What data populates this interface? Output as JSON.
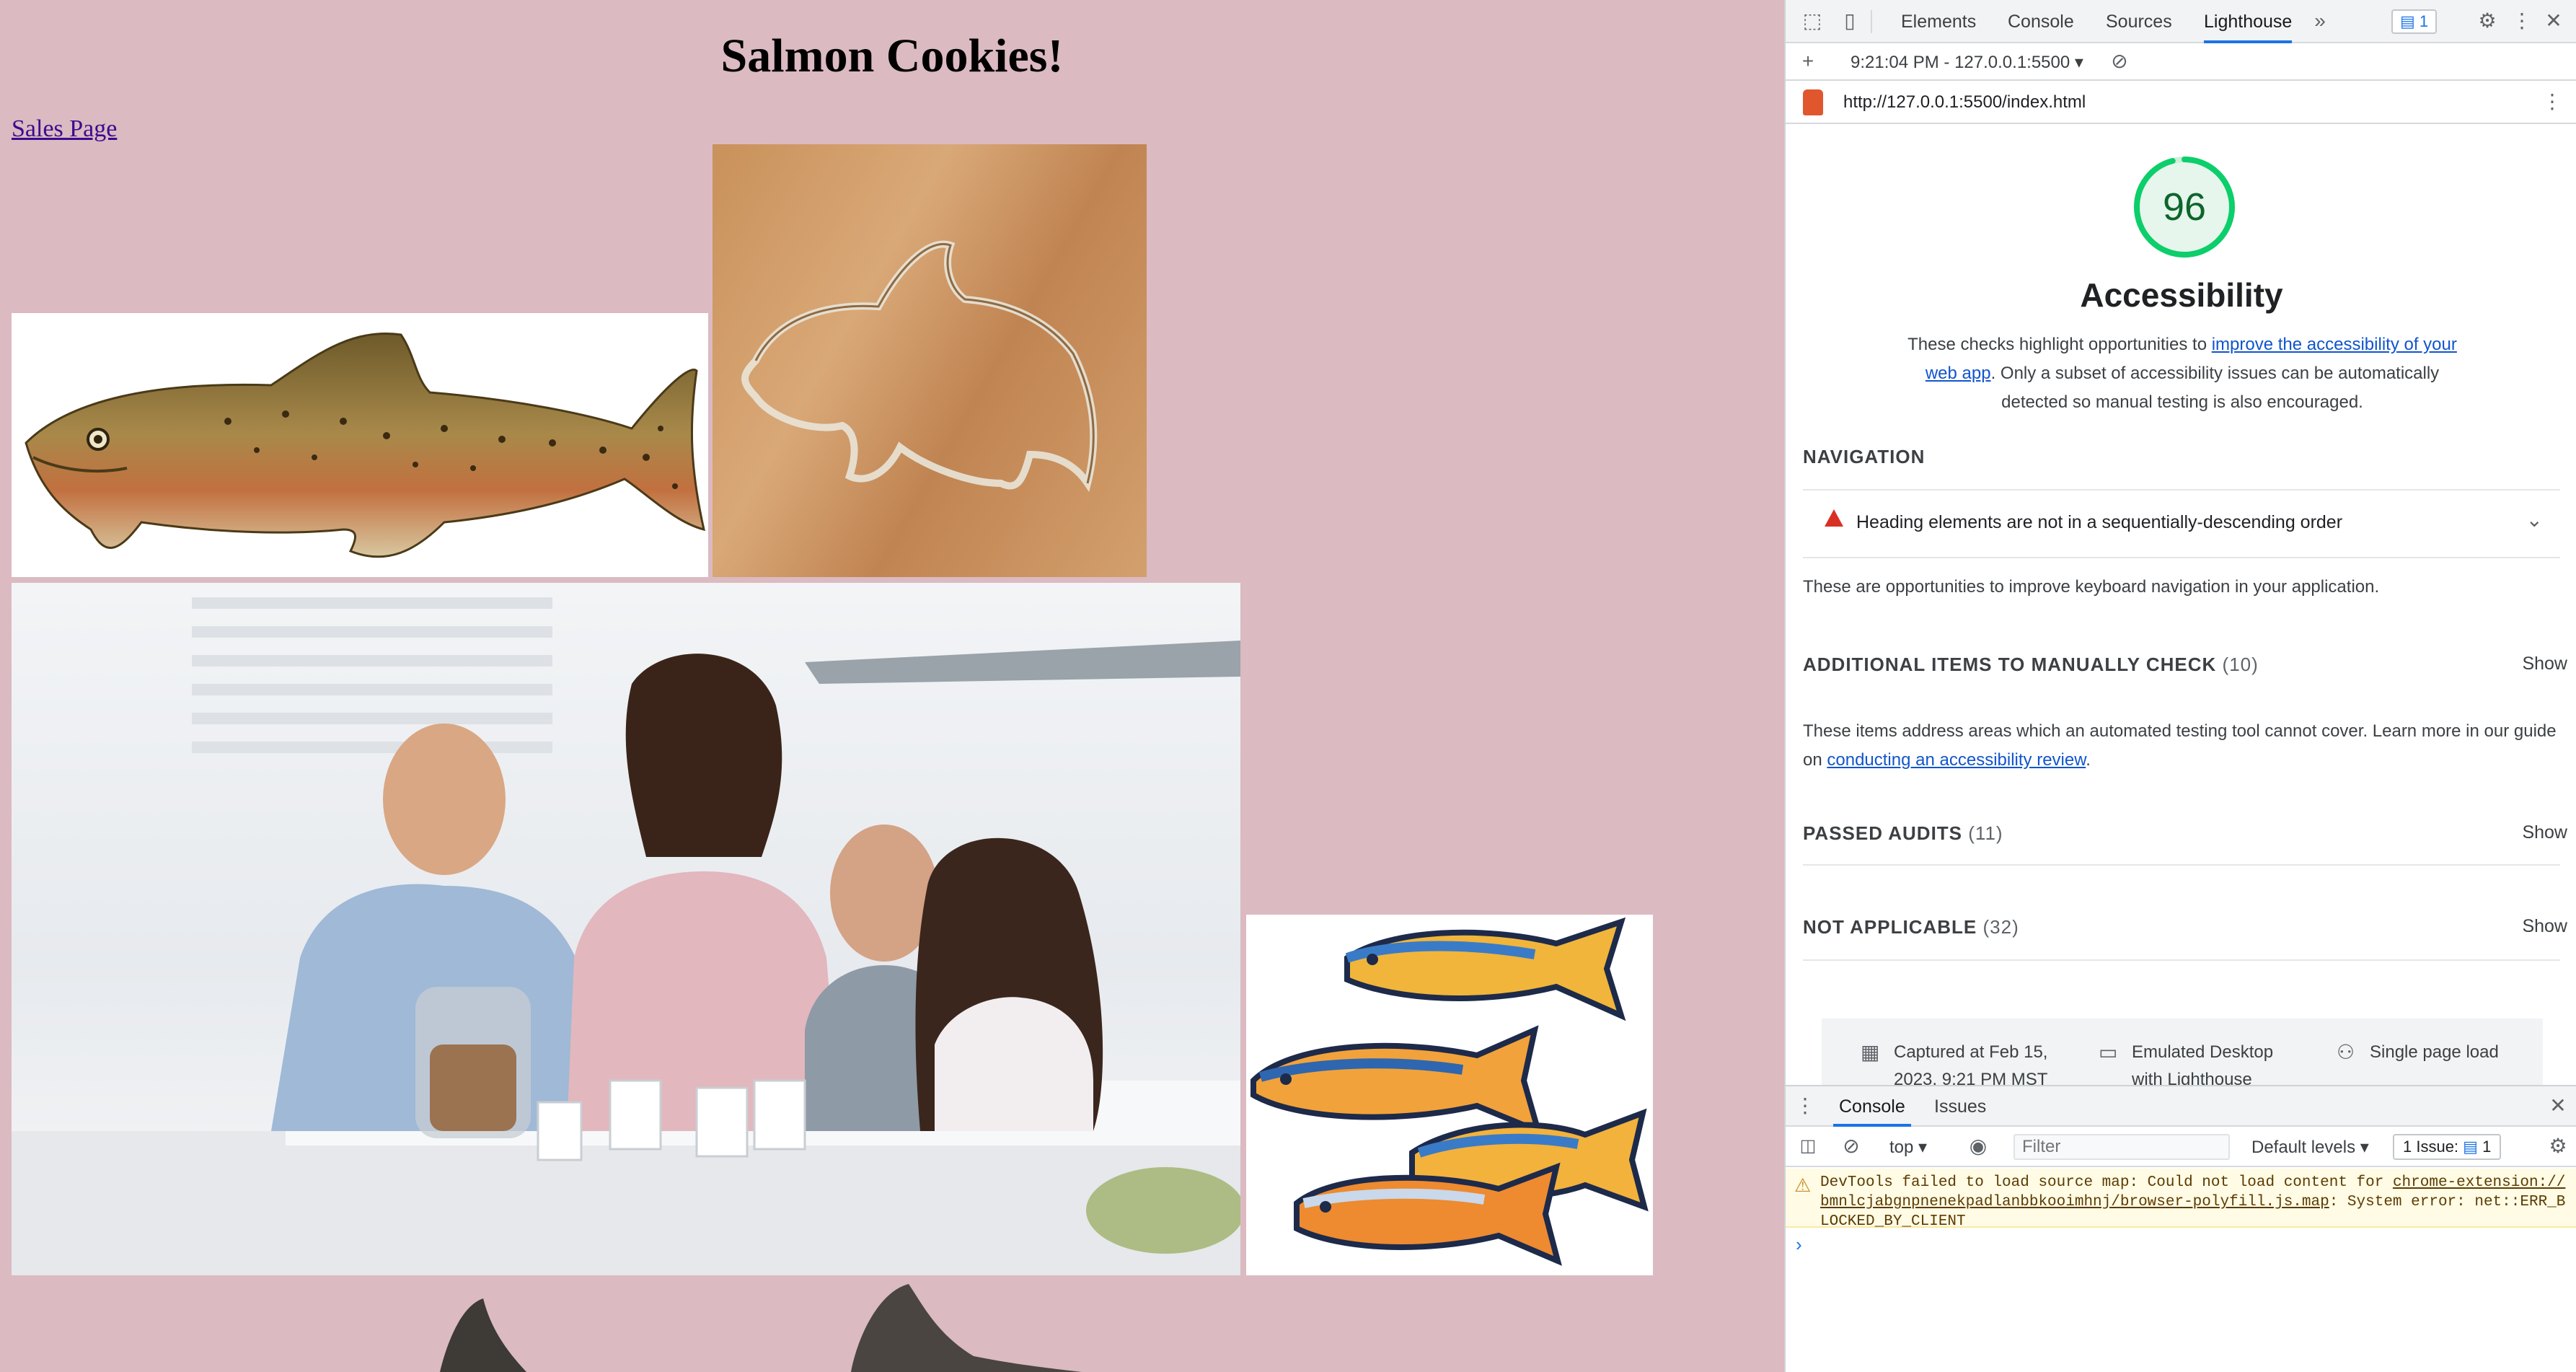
{
  "page": {
    "title": "Salmon Cookies!",
    "sales_link": "Sales Page"
  },
  "devtools": {
    "tabs": [
      "Elements",
      "Console",
      "Sources",
      "Lighthouse"
    ],
    "active_tab": "Lighthouse",
    "issues_count": "1",
    "report_label": "9:21:04 PM - 127.0.0.1:5500",
    "url": "http://127.0.0.1:5500/index.html",
    "category": {
      "score": 96,
      "score_fraction": 0.96,
      "title": "Accessibility",
      "desc_before": "These checks highlight opportunities to ",
      "desc_link": "improve the accessibility of your web app",
      "desc_after": ". Only a subset of accessibility issues can be automatically detected so manual testing is also encouraged."
    },
    "navigation": {
      "heading": "NAVIGATION",
      "audit": "Heading elements are not in a sequentially-descending order",
      "description": "These are opportunities to improve keyboard navigation in your application."
    },
    "manual": {
      "heading": "ADDITIONAL ITEMS TO MANUALLY CHECK",
      "count": "(10)",
      "show": "Show",
      "desc_before": "These items address areas which an automated testing tool cannot cover. Learn more in our guide on ",
      "desc_link": "conducting an accessibility review",
      "desc_after": "."
    },
    "passed": {
      "heading": "PASSED AUDITS",
      "count": "(11)",
      "show": "Show"
    },
    "not_applicable": {
      "heading": "NOT APPLICABLE",
      "count": "(32)",
      "show": "Show"
    },
    "footer": {
      "captured": "Captured at Feb 15, 2023, 9:21 PM MST",
      "emulated": "Emulated Desktop with Lighthouse",
      "mode": "Single page load"
    },
    "drawer": {
      "tabs": [
        "Console",
        "Issues"
      ],
      "context": "top",
      "filter_placeholder": "Filter",
      "levels": "Default levels",
      "issues_label": "1 Issue:",
      "issues_count": "1",
      "warning_before": "DevTools failed to load source map: Could not load content for ",
      "warning_link": "chrome-extension://bmnlcjabgnpnenekpadlanbbkooimhnj/browser-polyfill.js.map",
      "warning_after": ": System error: net::ERR_BLOCKED_BY_CLIENT",
      "prompt": "›"
    }
  },
  "colors": {
    "page_bg": "#dbbac1",
    "score_green": "#0cce6b",
    "score_text": "#0d652d",
    "accent_blue": "#1a73e8",
    "fail_red": "#d93025"
  }
}
